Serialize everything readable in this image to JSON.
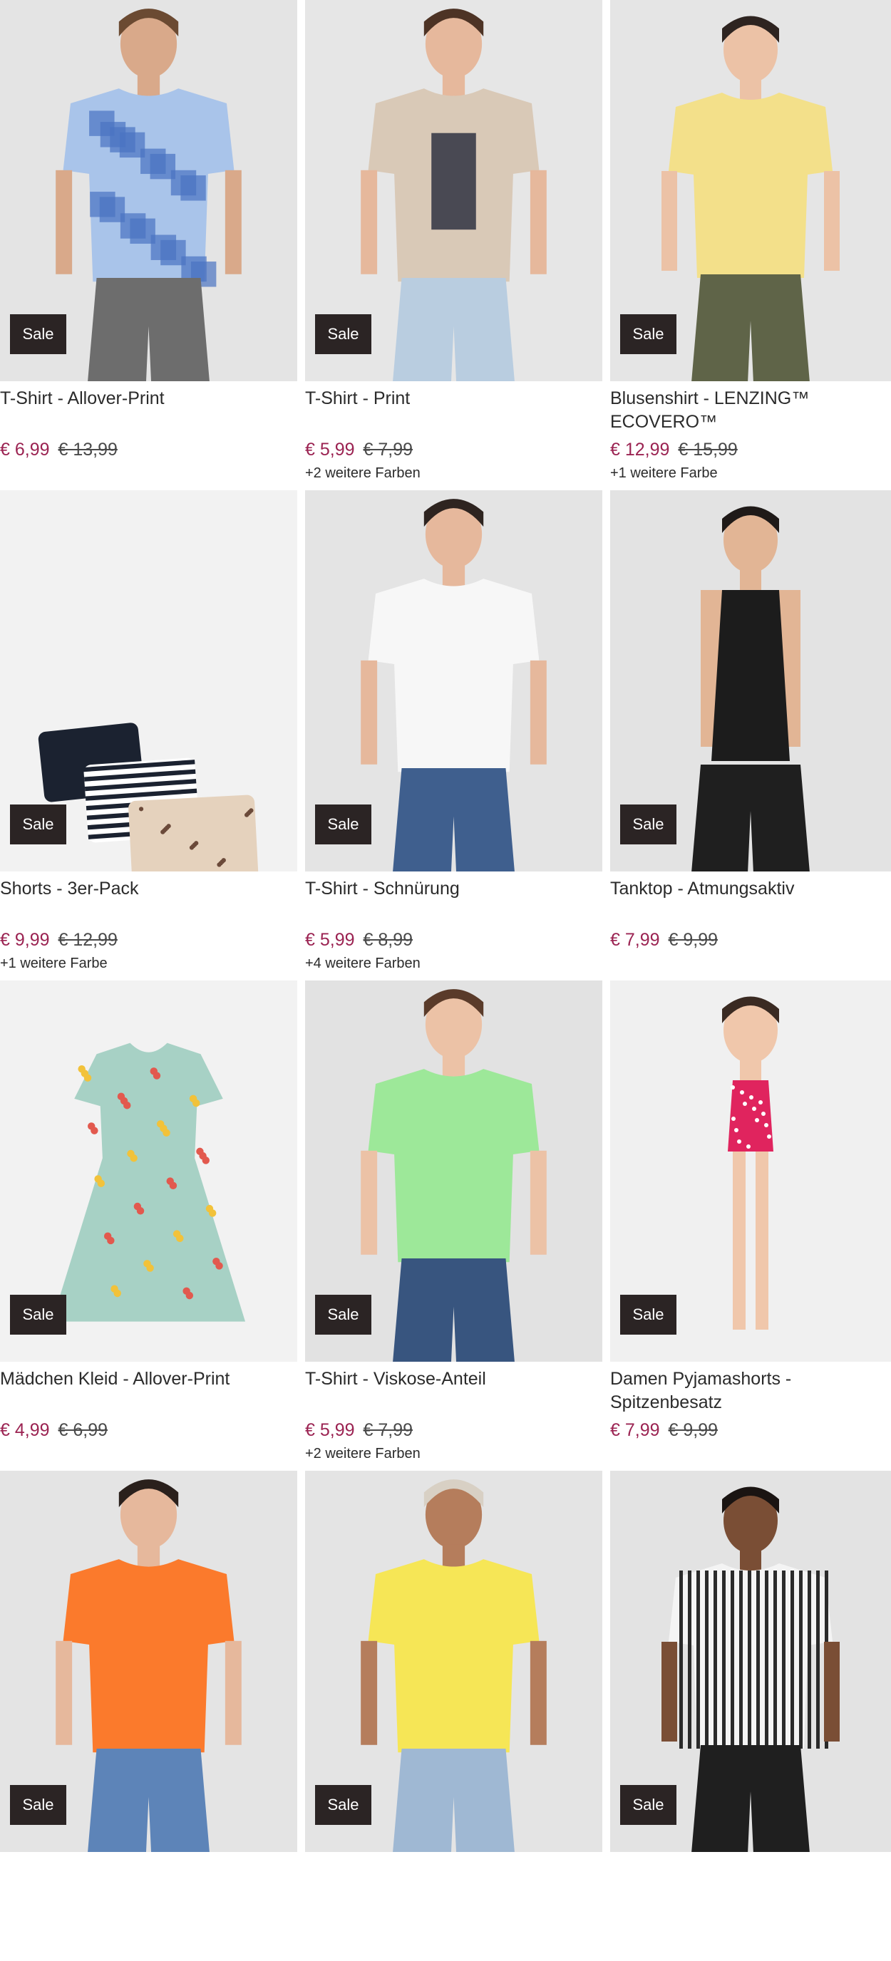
{
  "products": [
    {
      "title": "T-Shirt - Allover-Print",
      "price": "€ 6,99",
      "old_price": "€ 13,99",
      "colors": "",
      "badge": "Sale",
      "bg": "#e4e4e4",
      "garment": "#a9c4ea",
      "garment2": "#4a73c2",
      "legs": "#6d6d6d",
      "skin": "#d9a98a",
      "hair": "#6b4a32",
      "kind": "tee-man"
    },
    {
      "title": "T-Shirt - Print",
      "price": "€ 5,99",
      "old_price": "€ 7,99",
      "colors": "+2 weitere Farben",
      "badge": "Sale",
      "bg": "#e6e6e6",
      "garment": "#d9c9b7",
      "garment2": "#2f3342",
      "legs": "#b9cde0",
      "skin": "#e6b89c",
      "hair": "#4d3325",
      "kind": "tee-woman"
    },
    {
      "title": "Blusenshirt - LENZING™ ECOVERO™",
      "price": "€ 12,99",
      "old_price": "€ 15,99",
      "colors": "+1 weitere Farbe",
      "badge": "Sale",
      "bg": "#e5e5e5",
      "garment": "#f3e08a",
      "garment2": "#f3e08a",
      "legs": "#5f6448",
      "skin": "#ecc2a6",
      "hair": "#2e2420",
      "kind": "blouse-woman"
    },
    {
      "title": "Shorts - 3er-Pack",
      "price": "€ 9,99",
      "old_price": "€ 12,99",
      "colors": "+1 weitere Farbe",
      "badge": "Sale",
      "bg": "#f2f2f2",
      "garment": "#1b2230",
      "garment2": "#e5d2bd",
      "legs": "#ffffff",
      "skin": "#ffffff",
      "hair": "#ffffff",
      "kind": "shorts-pack"
    },
    {
      "title": "T-Shirt - Schnürung",
      "price": "€ 5,99",
      "old_price": "€ 8,99",
      "colors": "+4 weitere Farben",
      "badge": "Sale",
      "bg": "#e4e4e4",
      "garment": "#f7f7f7",
      "garment2": "#f7f7f7",
      "legs": "#3f5f8e",
      "skin": "#e6b89c",
      "hair": "#2e2420",
      "kind": "tee-woman"
    },
    {
      "title": "Tanktop - Atmungsaktiv",
      "price": "€ 7,99",
      "old_price": "€ 9,99",
      "colors": "",
      "badge": "Sale",
      "bg": "#e3e3e3",
      "garment": "#1c1c1c",
      "garment2": "#1c1c1c",
      "legs": "#1f1f1f",
      "skin": "#e2b595",
      "hair": "#1f1a18",
      "kind": "tank-woman"
    },
    {
      "title": "Mädchen Kleid - Allover-Print",
      "price": "€ 4,99",
      "old_price": "€ 6,99",
      "colors": "",
      "badge": "Sale",
      "bg": "#f2f2f2",
      "garment": "#a7d1c5",
      "garment2": "#e2594e",
      "legs": "#ffffff",
      "skin": "#ffffff",
      "hair": "#ffffff",
      "kind": "dress"
    },
    {
      "title": "T-Shirt - Viskose-Anteil",
      "price": "€ 5,99",
      "old_price": "€ 7,99",
      "colors": "+2 weitere Farben",
      "badge": "Sale",
      "bg": "#e2e2e2",
      "garment": "#9de899",
      "garment2": "#9de899",
      "legs": "#38557f",
      "skin": "#ecc2a6",
      "hair": "#5a3b2a",
      "kind": "tee-woman"
    },
    {
      "title": "Damen Pyjamashorts - Spitzenbesatz",
      "price": "€ 7,99",
      "old_price": "€ 9,99",
      "colors": "",
      "badge": "Sale",
      "bg": "#f0f0f0",
      "garment": "#e0245e",
      "garment2": "#e0245e",
      "legs": "#f0c7ab",
      "skin": "#f0c7ab",
      "hair": "#3a2a22",
      "kind": "pyjama"
    },
    {
      "title": "",
      "price": "",
      "old_price": "",
      "colors": "",
      "badge": "Sale",
      "bg": "#e4e4e4",
      "garment": "#fb7a2c",
      "garment2": "#fb7a2c",
      "legs": "#5d84b8",
      "skin": "#e6b89c",
      "hair": "#2a201c",
      "kind": "tee-woman"
    },
    {
      "title": "",
      "price": "",
      "old_price": "",
      "colors": "",
      "badge": "Sale",
      "bg": "#e4e4e4",
      "garment": "#f6e656",
      "garment2": "#f6e656",
      "legs": "#9fb8d3",
      "skin": "#b57d5c",
      "hair": "#d8d0c4",
      "kind": "tee-woman"
    },
    {
      "title": "",
      "price": "",
      "old_price": "",
      "colors": "",
      "badge": "Sale",
      "bg": "#e3e3e3",
      "garment": "#f4f4f4",
      "garment2": "#2a2a2a",
      "legs": "#1f1f1f",
      "skin": "#7a4e35",
      "hair": "#1a1412",
      "kind": "stripe-shirt"
    }
  ]
}
